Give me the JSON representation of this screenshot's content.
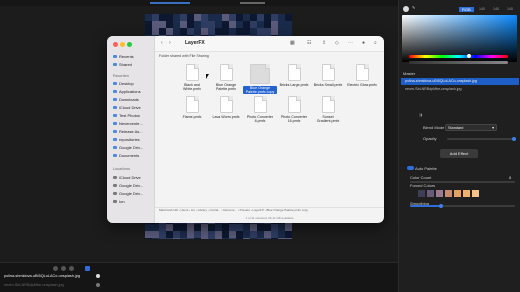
{
  "finder": {
    "title": "LayerFX",
    "subtitle": "Folder shared with File Sharing",
    "sidebar": {
      "items_top": [
        "Recents",
        "Shared"
      ],
      "favorites_label": "Favorites",
      "favorites": [
        "Desktop",
        "Applications",
        "Downloads",
        "iCloud Drive",
        "Test Photos",
        "Nevercente...",
        "Release As...",
        "repositories",
        "Google Driv...",
        "Documents"
      ],
      "locations_label": "Locations",
      "locations": [
        "iCloud Drive",
        "Google Driv...",
        "Google Driv...",
        "Ion"
      ]
    },
    "files": [
      "Black and White.pmfx",
      "Blue Orange Palette.pmfx",
      "Blue Orange Palette.pmfx copy",
      "Bricks Large.pmfx",
      "Bricks Small.pmfx",
      "Electric Glow.pmfx",
      "Flame.pmfx",
      "Lava Worm.pmfx",
      "Photo Converter 8.pmfx",
      "Photo Converter 16.pmfx",
      "Sunset Gradient.pmfx"
    ],
    "selected_file_index": 2,
    "pathbar": "Macintosh HD › Users › ion › Library › Contai... › Docume... › Presets › LayerFX › Blue Orange Palette.pmfx copy",
    "status": "1 of 11 selected, 66.11 GB available"
  },
  "right_panel": {
    "color_mode": "RGB",
    "rgb": [
      "140",
      "140",
      "140"
    ],
    "master_label": "Master",
    "layers": [
      "polina-shmidova-uBI5QLoLACo-unsplash.jpg",
      "neom-SbLNRBdpMbe-unsplash.jpg"
    ],
    "blend_mode_label": "Blend Mode",
    "blend_mode_value": "Standard",
    "opacity_label": "Opacity",
    "add_effect_label": "Add Effect",
    "auto_palette_label": "Auto Palette",
    "color_count_label": "Color Count",
    "color_count_value": "8",
    "forced_colors_label": "Forced Colors",
    "smoothing_label": "Smoothing",
    "palette_colors": [
      "#3d3d55",
      "#6a5a7a",
      "#9b7a90",
      "#c98a6e",
      "#e8a060",
      "#f0b070",
      "#f6c28a"
    ]
  },
  "bottom": {
    "layer_1": "polina-shmidova-uBI5QLoLACo-unsplash.jpg",
    "layer_2": "neom-SbLNRBdpMbe-unsplash.jpg"
  }
}
